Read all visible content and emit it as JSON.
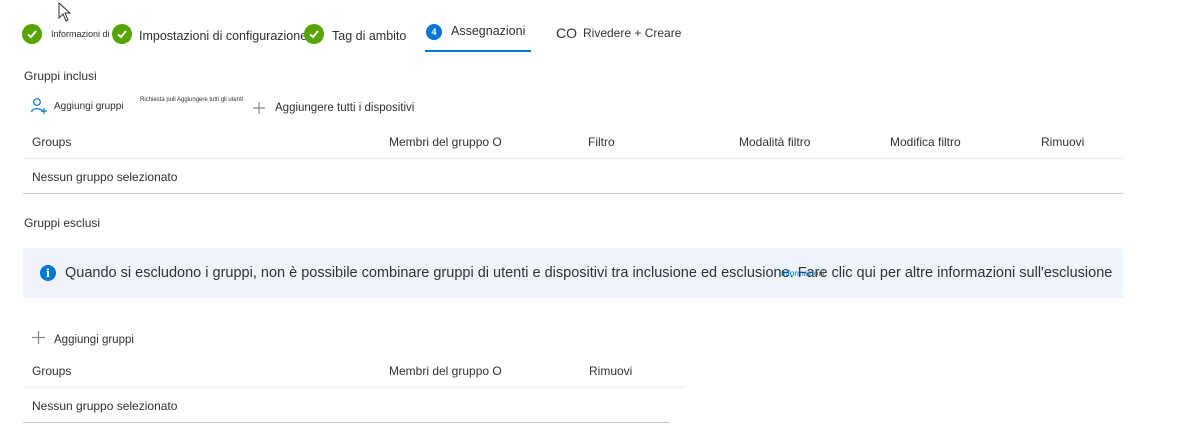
{
  "wizard": {
    "steps": [
      {
        "label": "Informazioni di base",
        "state": "done"
      },
      {
        "label": "Impostazioni di configurazione",
        "state": "done"
      },
      {
        "label": "Tag di ambito",
        "state": "done"
      },
      {
        "label": "Assegnazioni",
        "number": "4",
        "state": "current"
      },
      {
        "label": "Rivedere + Creare",
        "prefix": "CO",
        "state": "pending"
      }
    ]
  },
  "included": {
    "title": "Gruppi inclusi",
    "add_groups_label": "Aggiungi gruppi",
    "overlay_small": "Richiesta pull Aggiungere tutti gli utenti",
    "add_all_devices_label": "Aggiungere tutti i dispositivi",
    "columns": [
      "Groups",
      "Membri del gruppo O",
      "Filtro",
      "Modalità filtro",
      "Modifica filtro",
      "Rimuovi"
    ],
    "empty_text": "Nessun gruppo selezionato"
  },
  "excluded": {
    "title": "Gruppi esclusi",
    "banner_text": "Quando si escludono i gruppi, non è possibile combinare gruppi di utenti e dispositivi tra inclusione ed esclusione. Fare clic qui per altre informazioni sull'esclusione",
    "banner_link": "Informazioni",
    "add_groups_label": "Aggiungi gruppi",
    "columns": [
      "Groups",
      "Membri del gruppo O",
      "Rimuovi"
    ],
    "empty_text": "Nessun gruppo selezionato"
  },
  "colors": {
    "accent": "#0078d4",
    "success": "#57a300",
    "banner_bg": "#eff4fc"
  }
}
